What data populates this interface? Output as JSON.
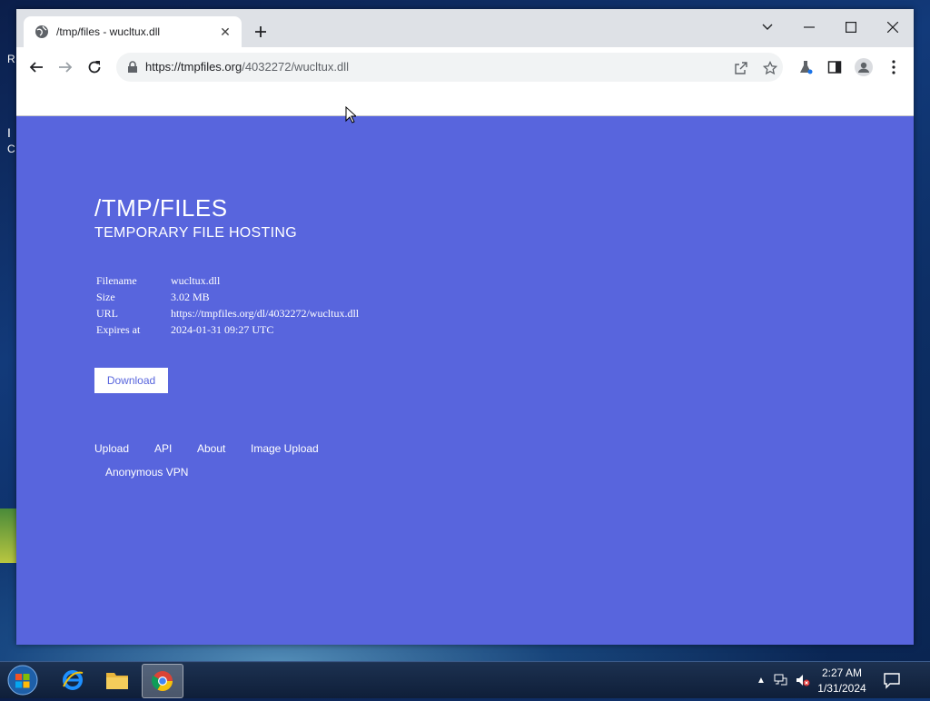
{
  "desktop": {
    "frag1": "R",
    "frag2": "I",
    "frag3": "C"
  },
  "browser": {
    "tab": {
      "title": "/tmp/files - wucltux.dll",
      "icon": "globe-icon"
    },
    "window_controls": [
      "chevron-down-icon",
      "minimize-icon",
      "maximize-icon",
      "close-icon"
    ],
    "toolbar": {
      "url_host": "https://tmpfiles.org",
      "url_path": "/4032272/wucltux.dll",
      "icons": [
        "back-icon",
        "forward-icon",
        "reload-icon",
        "lock-icon",
        "share-icon",
        "star-icon",
        "labs-icon",
        "sidepanel-icon",
        "profile-icon",
        "menu-icon"
      ]
    }
  },
  "page": {
    "title": "/TMP/FILES",
    "subtitle": "TEMPORARY FILE HOSTING",
    "info": [
      {
        "key": "Filename",
        "value": "wucltux.dll"
      },
      {
        "key": "Size",
        "value": "3.02 MB"
      },
      {
        "key": "URL",
        "value": "https://tmpfiles.org/dl/4032272/wucltux.dll"
      },
      {
        "key": "Expires at",
        "value": "2024-01-31 09:27 UTC"
      }
    ],
    "download_label": "Download",
    "footer_links": [
      "Upload",
      "API",
      "About",
      "Image Upload",
      "Anonymous VPN"
    ],
    "background_color": "#5865dd"
  },
  "taskbar": {
    "apps": [
      "internet-explorer-icon",
      "file-explorer-icon",
      "chrome-icon"
    ],
    "clock_time": "2:27 AM",
    "clock_date": "1/31/2024"
  }
}
